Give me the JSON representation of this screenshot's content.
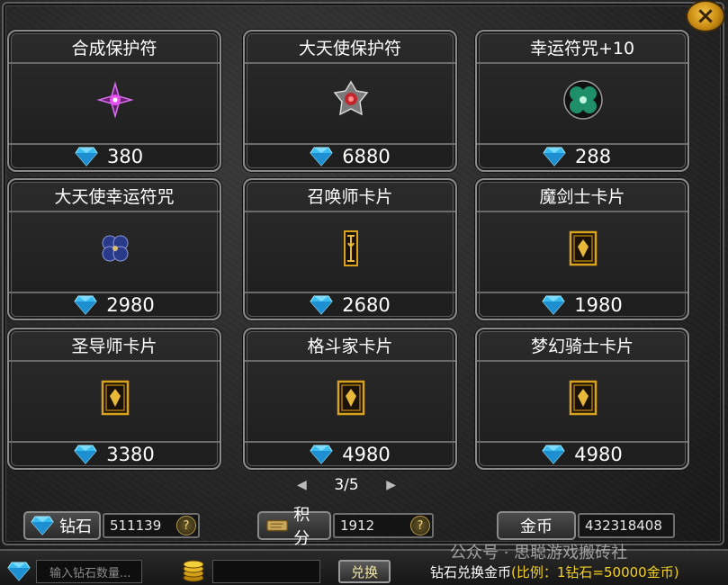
{
  "close_glyph": "×",
  "items": [
    {
      "name": "合成保护符",
      "price": "380",
      "icon": "purple-gem-cross-icon"
    },
    {
      "name": "大天使保护符",
      "price": "6880",
      "icon": "red-crest-icon"
    },
    {
      "name": "幸运符咒+10",
      "price": "288",
      "icon": "green-clover-charm-icon"
    },
    {
      "name": "大天使幸运符咒",
      "price": "2980",
      "icon": "blue-clover-charm-icon"
    },
    {
      "name": "召唤师卡片",
      "price": "2680",
      "icon": "summoner-card-icon"
    },
    {
      "name": "魔剑士卡片",
      "price": "1980",
      "icon": "magic-gladiator-card-icon"
    },
    {
      "name": "圣导师卡片",
      "price": "3380",
      "icon": "dark-lord-card-icon"
    },
    {
      "name": "格斗家卡片",
      "price": "4980",
      "icon": "fighter-card-icon"
    },
    {
      "name": "梦幻骑士卡片",
      "price": "4980",
      "icon": "knight-card-icon"
    }
  ],
  "pagination": {
    "label": "3/5"
  },
  "stats": {
    "diamond": {
      "label": "钻石",
      "value": "511139",
      "help": "?"
    },
    "points": {
      "label": "积分",
      "value": "1912",
      "help": "?"
    },
    "gold": {
      "label": "金币",
      "value": "432318408"
    }
  },
  "exchange": {
    "input_placeholder": "输入钻石数量...",
    "button": "兑换",
    "label": "钻石兑换金币",
    "rate": "(比例：1钻石=50000金币)"
  },
  "watermark": "公众号 · 思聪游戏搬砖社",
  "colors": {
    "diamond": "#3cc6f0",
    "gold_accent": "#f5d020",
    "card_icon_gold": "#d8a21c"
  }
}
